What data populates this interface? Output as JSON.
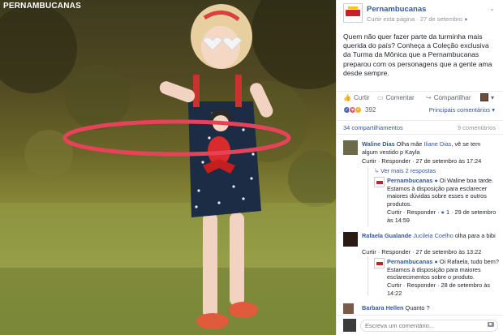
{
  "photo": {
    "brand": "PERNAMBUCANAS"
  },
  "post": {
    "page_name": "Pernambucanas",
    "meta_left": "Curtir esta página",
    "meta_date": "27 de setembro",
    "text": "Quem não quer fazer parte da turminha mais querida do país? Conheça a Coleção exclusiva da Turma da Mônica que a Pernambucanas preparou com os personagens que a gente ama desde sempre.",
    "actions": {
      "like": "Curtir",
      "comment": "Comentar",
      "share": "Compartilhar"
    },
    "reaction_count": "392",
    "comments_sort": "Principais comentários",
    "shares": "34 compartilhamentos",
    "comment_count": "9 comentários"
  },
  "comments": [
    {
      "author": "Waline Dias",
      "text_before": "Olha mãe",
      "tag": "Iliane Dias",
      "text_after": ", vê se tem algum vestido p Kayla",
      "actions": "Curtir · Responder",
      "time": "27 de setembro às 17:24",
      "view_replies": "Ver mais 2 respostas",
      "reply": {
        "author": "Pernambucanas",
        "text": "Oi Waline boa tarde. Estamos à disposição para esclarecer maiores dúvidas sobre esses e outros produtos.",
        "actions": "Curtir · Responder",
        "likes": "1",
        "time": "29 de setembro às 14:59"
      }
    },
    {
      "author": "Rafaela Gualande",
      "tag": "Jucileia Coelho",
      "text_after": "olha para a bibi",
      "actions": "Curtir · Responder",
      "time": "27 de setembro às 13:22",
      "reply": {
        "author": "Pernambucanas",
        "text": "Oi Rafaela, tudo bem? Estamos à disposição para maiores esclarecimentos sobre o produto.",
        "actions": "Curtir · Responder",
        "time": "28 de setembro às 14:22"
      }
    },
    {
      "author": "Barbara Hellen",
      "text_after": "Quanto ?"
    }
  ],
  "composer": {
    "placeholder": "Escreva um comentário..."
  },
  "colors": {
    "link": "#365899",
    "brand_red": "#c6202e",
    "hoop": "#e8425a"
  },
  "icons": [
    "like-icon",
    "comment-icon",
    "share-icon",
    "chevron-down-icon",
    "camera-icon",
    "verified-icon"
  ]
}
